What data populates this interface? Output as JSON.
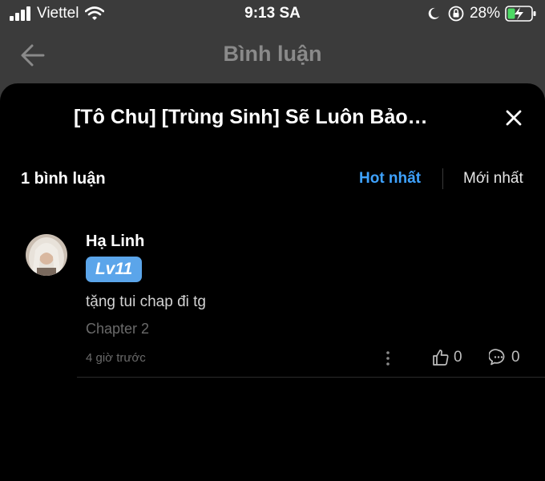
{
  "status_bar": {
    "carrier": "Viettel",
    "time": "9:13 SA",
    "battery_percent": "28%",
    "icons": [
      "signal-icon",
      "wifi-icon",
      "moon-icon",
      "orientation-lock-icon",
      "battery-charging-icon"
    ]
  },
  "header": {
    "title": "Bình luận",
    "back_icon": "arrow-left-icon"
  },
  "sheet": {
    "title": "[Tô Chu] [Trùng Sinh] Sẽ Luôn Bảo…",
    "close_icon": "close-icon",
    "comment_count": "1 bình luận",
    "sort_options": [
      "Hot nhất",
      "Mới nhất"
    ],
    "active_sort": "Hot nhất",
    "accent_color": "#3ea2ff"
  },
  "comments": [
    {
      "user_name": "Hạ Linh",
      "level": "Lv11",
      "text": "tặng tui chap đi tg",
      "chapter": "Chapter 2",
      "time": "4 giờ trước",
      "likes": "0",
      "replies": "0",
      "badge_color": "#5ba5ea"
    }
  ]
}
